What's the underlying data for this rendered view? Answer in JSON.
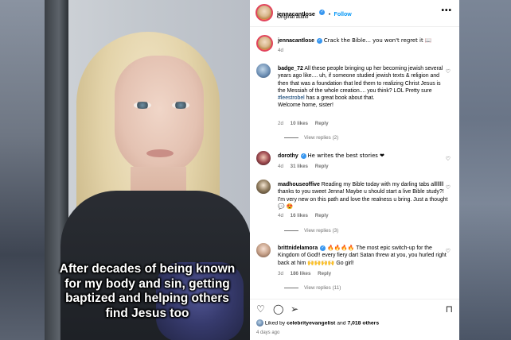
{
  "overlay_caption": "After decades of being known\nfor my body and sin, getting\nbaptized and helping others\nfind Jesus too",
  "header": {
    "username": "jennacantlose",
    "verified_icon": "verified-badge-icon",
    "separator": "•",
    "follow_label": "Follow",
    "audio": "Original audio",
    "more_icon": "•••"
  },
  "caption": {
    "username": "jennacantlose",
    "text": "Crack the Bible... you won't regret it 📖",
    "time": "4d"
  },
  "comments": [
    {
      "username": "badge_72",
      "text_before": "All these people bringing up her becoming jewish several years ago like.... uh, if someone studied jewish texts & religion and then that was a foundation that led them to realizing Christ Jesus is the Messiah of the whole creation.... you think? LOL Pretty sure ",
      "hashtag": "#leestrobel",
      "text_after": " has a great book about that.",
      "text_line2": "Welcome home, sister!",
      "time": "2d",
      "likes": "10 likes",
      "reply": "Reply",
      "view_replies": "View replies (2)"
    },
    {
      "username": "dorothy",
      "text": "He writes the best stories ❤",
      "time": "4d",
      "likes": "31 likes",
      "reply": "Reply"
    },
    {
      "username": "madhouseoffive",
      "text": "Reading my Bible today with my darling tabs allllllll thanks to you sweet Jenna! Maybe u should start a live Bible study?! I'm very new on this path and love the realness u bring. Just a thought 💬 😍",
      "time": "4d",
      "likes": "16 likes",
      "reply": "Reply",
      "view_replies": "View replies (3)"
    },
    {
      "username": "brittnidelamora",
      "text": "🔥🔥🔥🔥 The most epic switch-up for the Kingdom of God!! every fiery dart Satan threw at you, you hurled right back at him 🙌🙌🙌🙌 Go girl!",
      "time": "3d",
      "likes": "186 likes",
      "reply": "Reply",
      "view_replies": "View replies (11)"
    }
  ],
  "actions": {
    "like_icon": "♡",
    "comment_icon": "◯",
    "share_icon": "➢",
    "save_icon": "⊓"
  },
  "likes_summary": {
    "prefix": "Liked by",
    "user": "celebrityevangelist",
    "middle": "and",
    "others": "7,018 others"
  },
  "posted": "4 days ago",
  "comment_heart_icon": "♡"
}
